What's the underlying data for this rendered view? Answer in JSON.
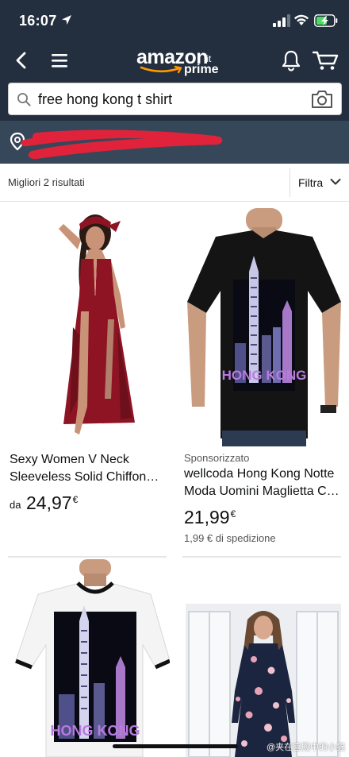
{
  "status_bar": {
    "time": "16:07"
  },
  "header": {
    "logo_text": "amazon",
    "logo_tld": ".it",
    "logo_prime": "prime",
    "accent_color": "#f90"
  },
  "search": {
    "query": "free hong kong t shirt"
  },
  "results": {
    "count_label": "Migliori 2 risultati",
    "filter_label": "Filtra"
  },
  "products": [
    {
      "sponsored": "",
      "title_line1": "Sexy Women V Neck",
      "title_line2": "Sleeveless Solid Chiffon…",
      "price_prefix": "da",
      "price": "24,97",
      "currency": "€",
      "shipping": ""
    },
    {
      "sponsored": "Sponsorizzato",
      "title_line1": "wellcoda Hong Kong Notte",
      "title_line2": "Moda Uomini Maglietta C…",
      "price_prefix": "",
      "price": "21,99",
      "currency": "€",
      "shipping": "1,99 € di spedizione"
    },
    {
      "sponsored": "",
      "title_line1": "",
      "title_line2": "",
      "price_prefix": "",
      "price": "",
      "currency": "",
      "shipping": ""
    },
    {
      "sponsored": "",
      "title_line1": "",
      "title_line2": "",
      "price_prefix": "",
      "price": "",
      "currency": "",
      "shipping": ""
    }
  ],
  "tshirt_print": "HONG KONG",
  "watermark": "@夹在宫殿中的小猫",
  "colors": {
    "nav_bg": "#232f3e",
    "location_bg": "#37475a",
    "redaction": "#e0233a",
    "dress_red": "#8e1424",
    "tshirt_black": "#141414"
  }
}
